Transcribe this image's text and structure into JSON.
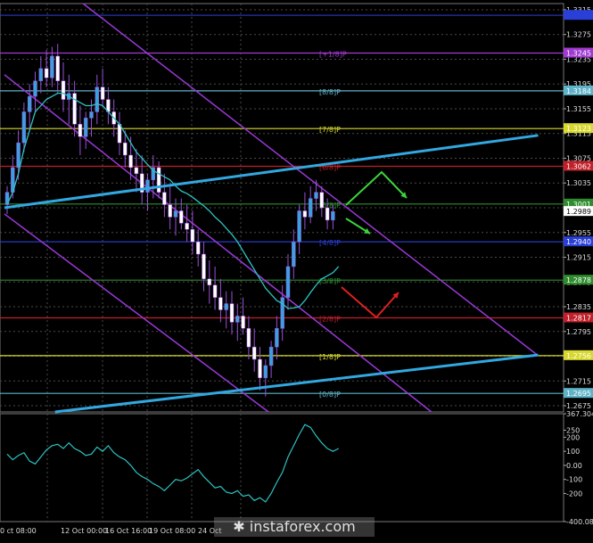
{
  "chart_data": [
    {
      "type": "candlestick",
      "instrument_hint": "GBP/USD",
      "title": "",
      "ylim": [
        1.2665,
        1.3325
      ],
      "grid": true,
      "x_tick_labels": [
        "9 Oct 08:00",
        "12 Oct 00:00",
        "16 Oct 16:00",
        "19 Oct 08:00",
        "24 Oct"
      ],
      "y_tick_labels": [
        "1.3315",
        "1.3275",
        "1.3235",
        "1.3195",
        "1.3155",
        "1.3115",
        "1.3075",
        "1.3035",
        "1.2995",
        "1.2955",
        "1.2915",
        "1.2875",
        "1.2835",
        "1.2795",
        "1.2755",
        "1.2715",
        "1.2675"
      ],
      "last_price": "1.2989",
      "murrey_levels": [
        {
          "label": "[+1/8]P",
          "price": "1.3245",
          "value": 1.3245,
          "color": "#a03bd0"
        },
        {
          "label": "[8/8]P",
          "price": "1.3184",
          "value": 1.3184,
          "color": "#5fb3c8"
        },
        {
          "label": "[7/8]P",
          "price": "1.3123",
          "value": 1.3123,
          "color": "#d8d830"
        },
        {
          "label": "[6/8]P",
          "price": "1.3062",
          "value": 1.3062,
          "color": "#c0202a"
        },
        {
          "label": "[5/8]P",
          "price": "1.3001",
          "value": 1.3001,
          "color": "#2e8b2e"
        },
        {
          "label": "[4/8]P",
          "price": "1.2940",
          "value": 1.294,
          "color": "#2a3fd6"
        },
        {
          "label": "[3/8]P",
          "price": "1.2878",
          "value": 1.2878,
          "color": "#2e8b2e"
        },
        {
          "label": "[2/8]P",
          "price": "1.2817",
          "value": 1.2817,
          "color": "#c0202a"
        },
        {
          "label": "[1/8]P",
          "price": "1.2756",
          "value": 1.2756,
          "color": "#d8d830"
        },
        {
          "label": "[0/8]P",
          "price": "1.2695",
          "value": 1.2695,
          "color": "#5fb3c8"
        }
      ],
      "top_level": {
        "price": "1.3306",
        "value": 1.3306,
        "color": "#2a3fd6"
      },
      "trend_lines": [
        {
          "name": "upper-blue-trendline",
          "color": "#32a8e0",
          "from": {
            "bar": 0,
            "price": 1.2995
          },
          "to": {
            "bar": 95,
            "price": 1.3112
          }
        },
        {
          "name": "lower-blue-trendline",
          "color": "#32a8e0",
          "from": {
            "bar": 9,
            "price": 1.2665
          },
          "to": {
            "bar": 95,
            "price": 1.2757
          }
        }
      ],
      "channel_lines": [
        {
          "color": "#9b38d8",
          "from": {
            "bar": 14,
            "price": 1.3325
          },
          "to": {
            "bar": 95,
            "price": 1.2756
          }
        },
        {
          "color": "#9b38d8",
          "from": {
            "bar": 0,
            "price": 1.321
          },
          "to": {
            "bar": 76,
            "price": 1.2665
          }
        },
        {
          "color": "#9b38d8",
          "from": {
            "bar": 0,
            "price": 1.2985
          },
          "to": {
            "bar": 47,
            "price": 1.2665
          }
        }
      ],
      "moving_average": {
        "color": "#2ec2c2",
        "values": [
          1.3,
          1.302,
          1.305,
          1.309,
          1.312,
          1.315,
          1.316,
          1.317,
          1.3175,
          1.318,
          1.318,
          1.3175,
          1.317,
          1.3165,
          1.316,
          1.316,
          1.3163,
          1.316,
          1.315,
          1.314,
          1.313,
          1.3115,
          1.31,
          1.3085,
          1.3075,
          1.3065,
          1.3055,
          1.305,
          1.3045,
          1.304,
          1.303,
          1.3022,
          1.3018,
          1.3012,
          1.3005,
          1.2998,
          1.299,
          1.298,
          1.2972,
          1.2962,
          1.2952,
          1.294,
          1.2925,
          1.291,
          1.2895,
          1.288,
          1.2865,
          1.2855,
          1.2845,
          1.284,
          1.2832,
          1.2833,
          1.2835,
          1.2845,
          1.2858,
          1.287,
          1.288,
          1.2885,
          1.289,
          1.29
        ]
      },
      "candles": [
        [
          1.3,
          1.303,
          1.2985,
          1.302
        ],
        [
          1.302,
          1.308,
          1.301,
          1.306
        ],
        [
          1.306,
          1.312,
          1.304,
          1.31
        ],
        [
          1.31,
          1.3165,
          1.3085,
          1.315
        ],
        [
          1.315,
          1.3195,
          1.312,
          1.3175
        ],
        [
          1.3175,
          1.3215,
          1.315,
          1.32
        ],
        [
          1.32,
          1.324,
          1.318,
          1.322
        ],
        [
          1.322,
          1.325,
          1.319,
          1.3205
        ],
        [
          1.3205,
          1.3255,
          1.319,
          1.324
        ],
        [
          1.324,
          1.326,
          1.318,
          1.32
        ],
        [
          1.32,
          1.323,
          1.315,
          1.317
        ],
        [
          1.317,
          1.321,
          1.313,
          1.318
        ],
        [
          1.318,
          1.32,
          1.311,
          1.313
        ],
        [
          1.313,
          1.316,
          1.308,
          1.311
        ],
        [
          1.311,
          1.315,
          1.309,
          1.314
        ],
        [
          1.314,
          1.317,
          1.311,
          1.315
        ],
        [
          1.315,
          1.321,
          1.313,
          1.319
        ],
        [
          1.319,
          1.322,
          1.316,
          1.317
        ],
        [
          1.317,
          1.319,
          1.313,
          1.315
        ],
        [
          1.315,
          1.317,
          1.311,
          1.313
        ],
        [
          1.313,
          1.315,
          1.308,
          1.31
        ],
        [
          1.31,
          1.312,
          1.306,
          1.308
        ],
        [
          1.308,
          1.311,
          1.304,
          1.306
        ],
        [
          1.306,
          1.309,
          1.302,
          1.305
        ],
        [
          1.305,
          1.308,
          1.3,
          1.302
        ],
        [
          1.302,
          1.305,
          1.299,
          1.304
        ],
        [
          1.304,
          1.308,
          1.301,
          1.306
        ],
        [
          1.306,
          1.307,
          1.301,
          1.302
        ],
        [
          1.302,
          1.305,
          1.298,
          1.3
        ],
        [
          1.3,
          1.303,
          1.296,
          1.298
        ],
        [
          1.298,
          1.301,
          1.295,
          1.299
        ],
        [
          1.299,
          1.301,
          1.296,
          1.297
        ],
        [
          1.297,
          1.3,
          1.294,
          1.296
        ],
        [
          1.296,
          1.299,
          1.292,
          1.294
        ],
        [
          1.294,
          1.296,
          1.29,
          1.292
        ],
        [
          1.292,
          1.294,
          1.286,
          1.288
        ],
        [
          1.288,
          1.291,
          1.284,
          1.287
        ],
        [
          1.287,
          1.29,
          1.283,
          1.285
        ],
        [
          1.285,
          1.288,
          1.281,
          1.283
        ],
        [
          1.283,
          1.286,
          1.28,
          1.284
        ],
        [
          1.284,
          1.286,
          1.279,
          1.281
        ],
        [
          1.281,
          1.284,
          1.278,
          1.282
        ],
        [
          1.282,
          1.285,
          1.279,
          1.28
        ],
        [
          1.28,
          1.282,
          1.275,
          1.277
        ],
        [
          1.277,
          1.28,
          1.273,
          1.275
        ],
        [
          1.275,
          1.277,
          1.27,
          1.272
        ],
        [
          1.272,
          1.275,
          1.269,
          1.274
        ],
        [
          1.274,
          1.278,
          1.272,
          1.277
        ],
        [
          1.277,
          1.282,
          1.275,
          1.28
        ],
        [
          1.28,
          1.287,
          1.278,
          1.285
        ],
        [
          1.285,
          1.292,
          1.283,
          1.29
        ],
        [
          1.29,
          1.296,
          1.288,
          1.294
        ],
        [
          1.294,
          1.3,
          1.292,
          1.299
        ],
        [
          1.299,
          1.302,
          1.296,
          1.298
        ],
        [
          1.298,
          1.303,
          1.297,
          1.301
        ],
        [
          1.301,
          1.304,
          1.299,
          1.302
        ],
        [
          1.302,
          1.303,
          1.298,
          1.2995
        ],
        [
          1.2995,
          1.301,
          1.296,
          1.2975
        ],
        [
          1.2975,
          1.3,
          1.296,
          1.2989
        ]
      ]
    },
    {
      "type": "line",
      "name": "",
      "ylim": [
        -400,
        367.3047
      ],
      "y_tick_labels": [
        "367.3047",
        "250",
        "200",
        "100",
        "0.00",
        "-100",
        "-200",
        "-400.0808"
      ],
      "x_tick_labels": [
        "0 ct 08:00",
        "12 Oct 00:00",
        "16 Oct 16:00",
        "19 Oct 08:00",
        "24 Oct"
      ],
      "color": "#2ec2c2",
      "values": [
        80,
        40,
        70,
        90,
        30,
        10,
        60,
        110,
        140,
        150,
        120,
        160,
        120,
        100,
        70,
        80,
        130,
        100,
        140,
        90,
        60,
        40,
        0,
        -50,
        -80,
        -100,
        -130,
        -150,
        -180,
        -140,
        -100,
        -110,
        -90,
        -60,
        -30,
        -80,
        -120,
        -160,
        -150,
        -190,
        -200,
        -180,
        -220,
        -210,
        -250,
        -230,
        -260,
        -200,
        -120,
        -50,
        60,
        140,
        220,
        290,
        270,
        210,
        160,
        120,
        100,
        120
      ]
    }
  ],
  "ui": {
    "watermark": "instaforex.com",
    "watermark_icon": "snowflake-icon",
    "grid_color": "#4a4a4a"
  }
}
